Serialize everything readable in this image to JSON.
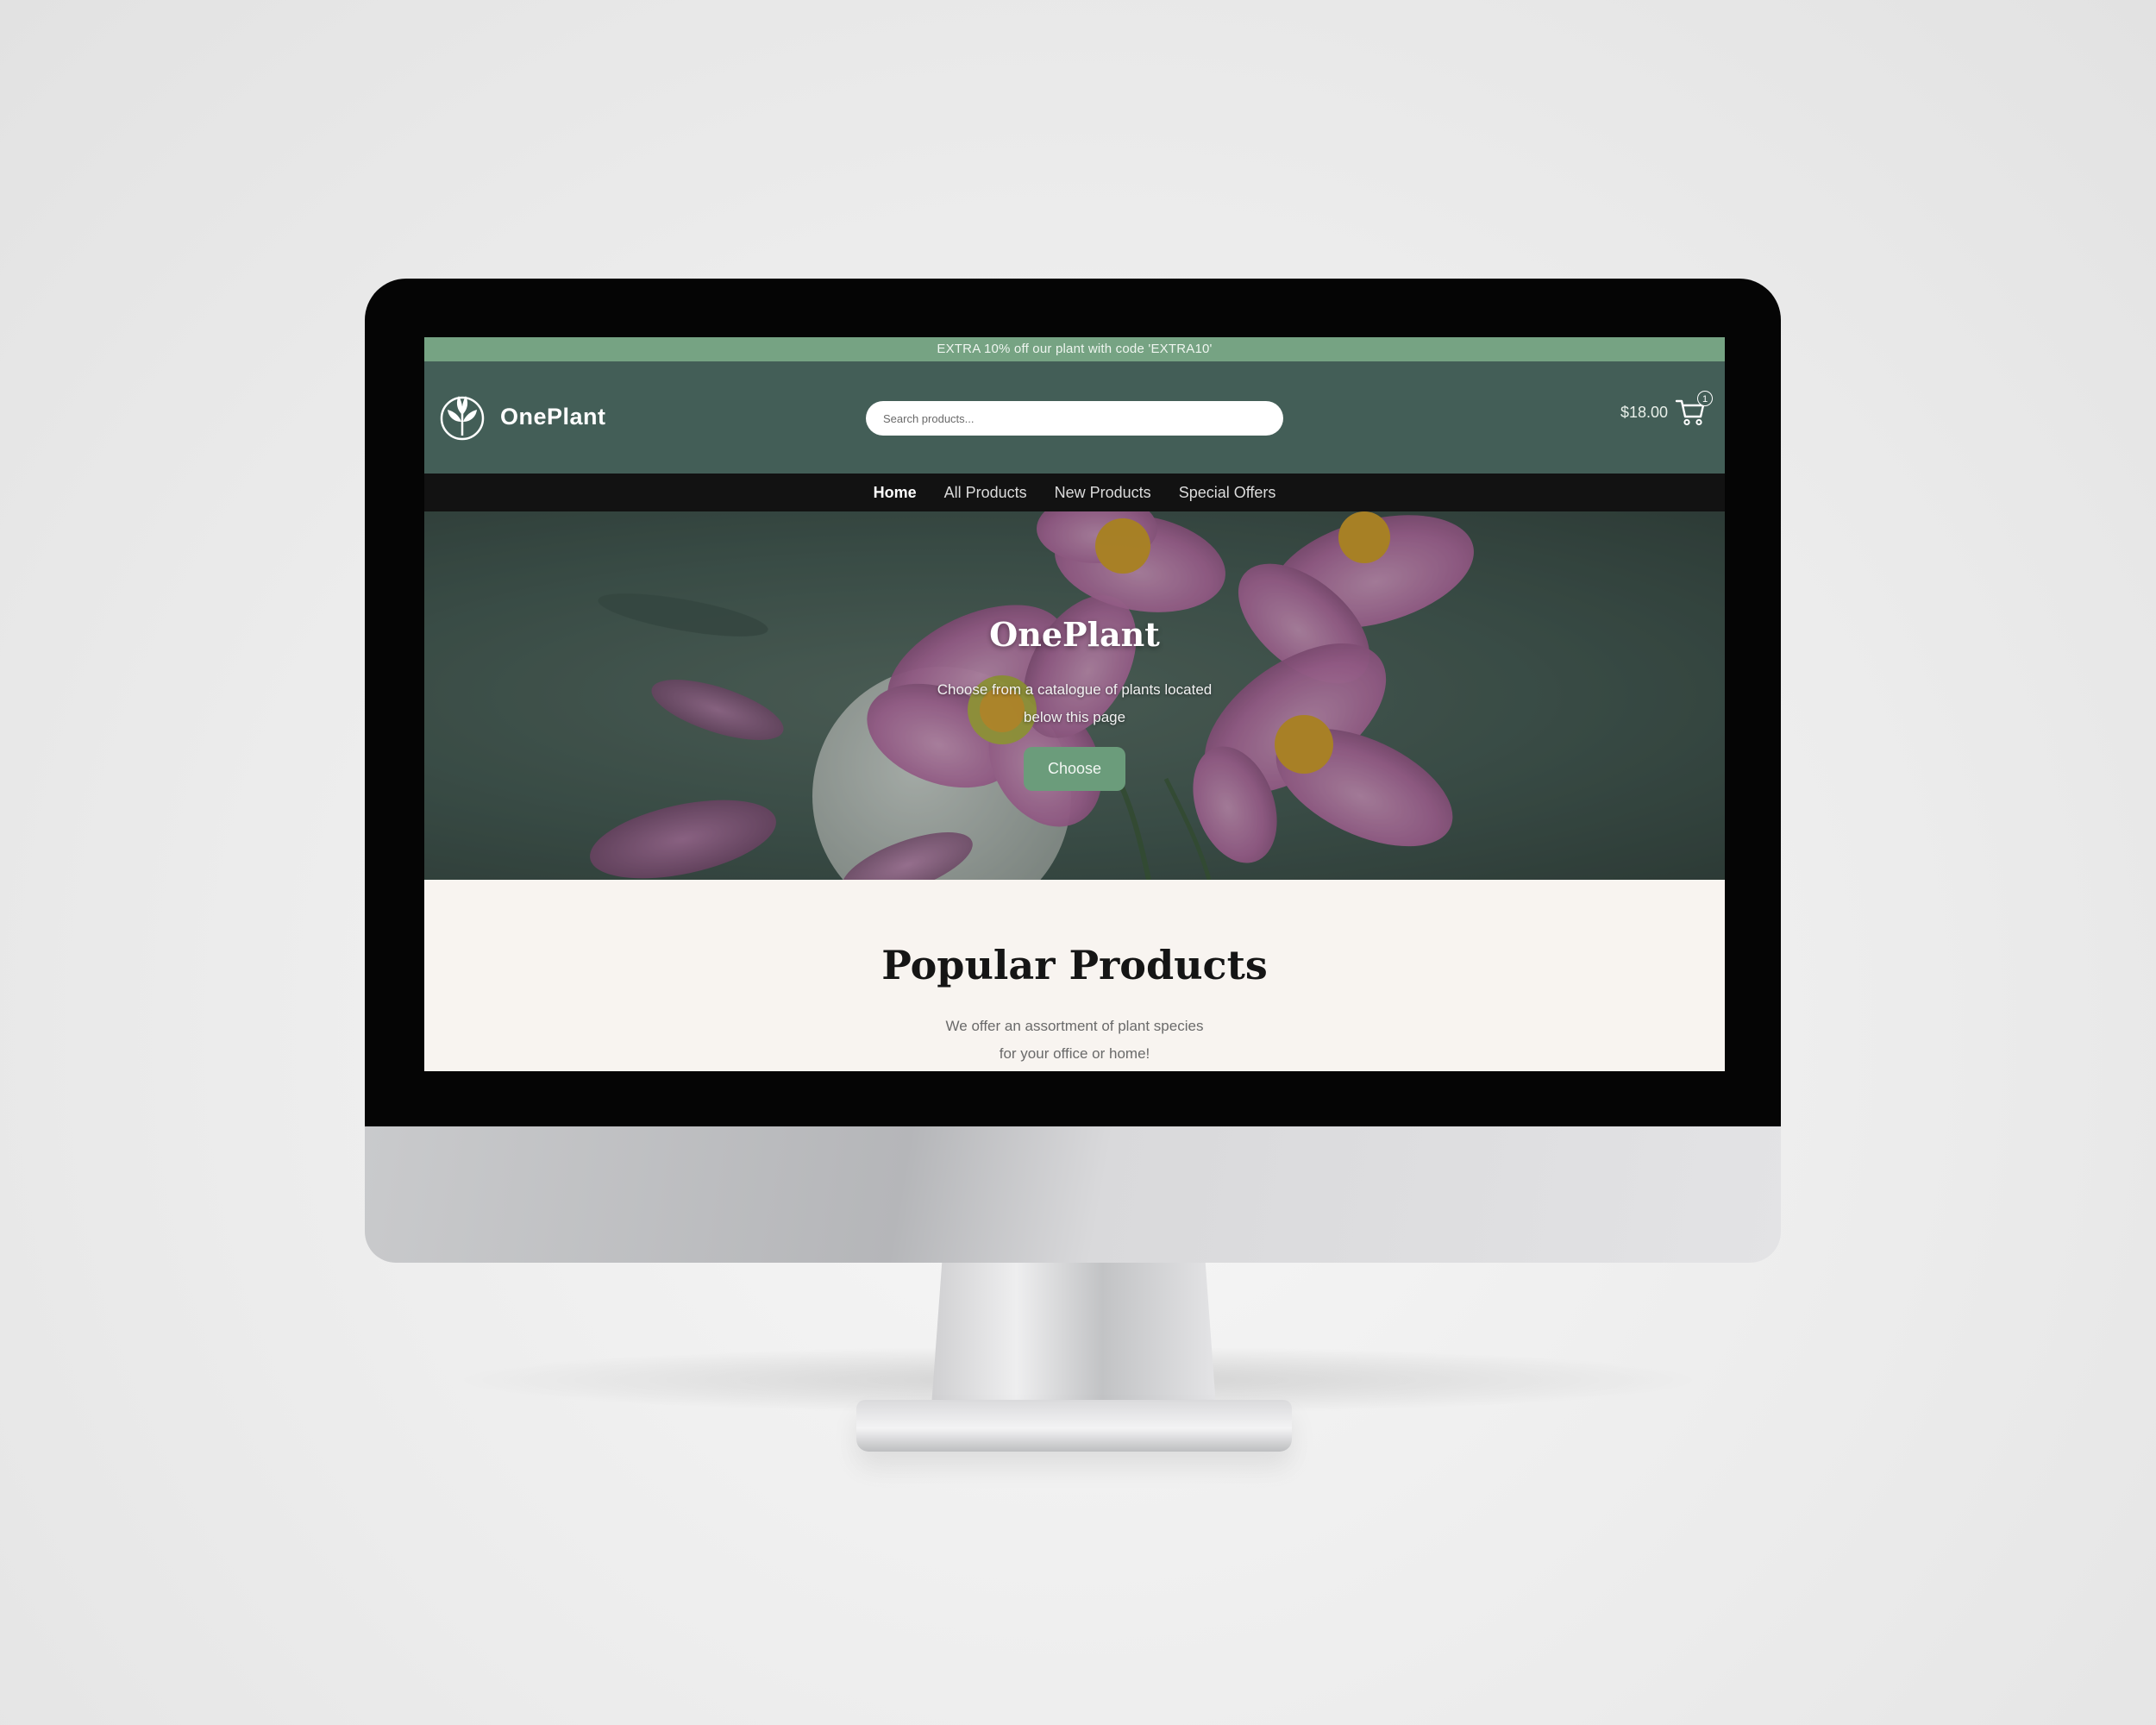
{
  "promo": {
    "text": "EXTRA 10% off our plant with code 'EXTRA10'"
  },
  "header": {
    "brand": "OnePlant",
    "search_placeholder": "Search products...",
    "cart_total": "$18.00",
    "cart_count": "1"
  },
  "nav": {
    "items": [
      {
        "label": "Home",
        "active": true
      },
      {
        "label": "All Products",
        "active": false
      },
      {
        "label": "New Products",
        "active": false
      },
      {
        "label": "Special Offers",
        "active": false
      }
    ]
  },
  "hero": {
    "title": "OnePlant",
    "subtitle": "Choose from a catalogue of plants located below this page",
    "button_label": "Choose"
  },
  "popular": {
    "title": "Popular Products",
    "subtitle": "We offer an assortment of plant species for your office or home!"
  },
  "colors": {
    "promo_bar": "#76a383",
    "header": "#435e57",
    "nav": "#121212",
    "accent_button": "#6b9c7b",
    "section_bg": "#f8f4f0"
  },
  "icons": [
    "leaf-logo-icon",
    "cart-icon"
  ]
}
